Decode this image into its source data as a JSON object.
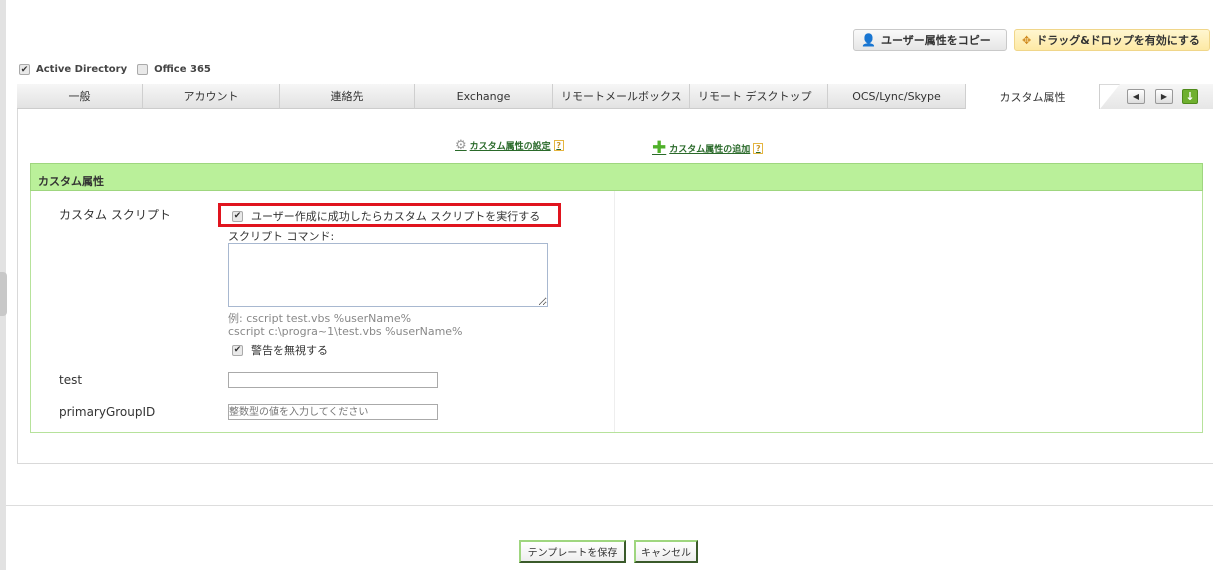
{
  "toolbar": {
    "copy_label": "ユーザー属性をコピー",
    "dnd_label": "ドラッグ&ドロップを有効にする"
  },
  "sources": [
    {
      "label": "Active Directory",
      "checked": true
    },
    {
      "label": "Office 365",
      "checked": false
    }
  ],
  "tabs": [
    "一般",
    "アカウント",
    "連絡先",
    "Exchange",
    "リモートメールボックス",
    "リモート デスクトップ",
    "OCS/Lync/Skype",
    "カスタム属性"
  ],
  "active_tab": "カスタム属性",
  "links": {
    "settings": "カスタム属性の設定",
    "add": "カスタム属性の追加",
    "help": "?"
  },
  "section": {
    "title": "カスタム属性",
    "script_label": "カスタム スクリプト",
    "run_script_label": "ユーザー作成に成功したらカスタム スクリプトを実行する",
    "command_label": "スクリプト コマンド:",
    "command_value": "",
    "example1": "例: cscript test.vbs %userName%",
    "example2": "cscript c:\\progra~1\\test.vbs %userName%",
    "ignore_warning_label": "警告を無視する",
    "test_label": "test",
    "test_value": "",
    "pgid_label": "primaryGroupID",
    "pgid_placeholder": "整数型の値を入力してください"
  },
  "footer": {
    "save": "テンプレートを保存",
    "cancel": "キャンセル"
  }
}
